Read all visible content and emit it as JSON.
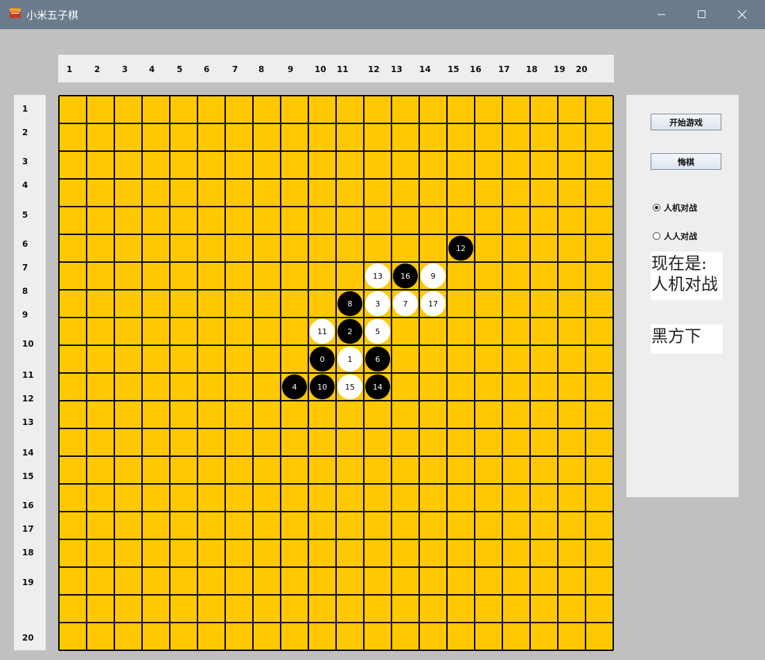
{
  "window": {
    "title": "小米五子棋",
    "controls": [
      "minimize",
      "maximize",
      "close"
    ]
  },
  "board": {
    "columns": [
      "1",
      "2",
      "3",
      "4",
      "5",
      "6",
      "7",
      "8",
      "9",
      "10",
      "11",
      "12",
      "13",
      "14",
      "15",
      "16",
      "17",
      "18",
      "19",
      "20"
    ],
    "rows": [
      "1",
      "2",
      "3",
      "4",
      "5",
      "6",
      "7",
      "8",
      "9",
      "10",
      "11",
      "12",
      "13",
      "14",
      "15",
      "16",
      "17",
      "18",
      "19",
      "20"
    ],
    "board_color": "#FFC800",
    "line_color": "#000000",
    "stones": [
      {
        "label": "12",
        "color": "black",
        "row": 6,
        "col": 15
      },
      {
        "label": "13",
        "color": "white",
        "row": 7,
        "col": 12
      },
      {
        "label": "16",
        "color": "black",
        "row": 7,
        "col": 13
      },
      {
        "label": "9",
        "color": "white",
        "row": 7,
        "col": 14
      },
      {
        "label": "8",
        "color": "black",
        "row": 8,
        "col": 11
      },
      {
        "label": "3",
        "color": "white",
        "row": 8,
        "col": 12
      },
      {
        "label": "7",
        "color": "white",
        "row": 8,
        "col": 13
      },
      {
        "label": "17",
        "color": "white",
        "row": 8,
        "col": 14
      },
      {
        "label": "11",
        "color": "white",
        "row": 9,
        "col": 10
      },
      {
        "label": "2",
        "color": "black",
        "row": 9,
        "col": 11
      },
      {
        "label": "5",
        "color": "white",
        "row": 9,
        "col": 12
      },
      {
        "label": "0",
        "color": "black",
        "row": 10,
        "col": 10
      },
      {
        "label": "1",
        "color": "white",
        "row": 10,
        "col": 11
      },
      {
        "label": "6",
        "color": "black",
        "row": 10,
        "col": 12
      },
      {
        "label": "4",
        "color": "black",
        "row": 11,
        "col": 9
      },
      {
        "label": "10",
        "color": "black",
        "row": 11,
        "col": 10
      },
      {
        "label": "15",
        "color": "white",
        "row": 11,
        "col": 11
      },
      {
        "label": "14",
        "color": "black",
        "row": 11,
        "col": 12
      }
    ]
  },
  "panel": {
    "start_button": "开始游戏",
    "undo_button": "悔棋",
    "mode_options": [
      {
        "label": "人机对战",
        "selected": true
      },
      {
        "label": "人人对战",
        "selected": false
      }
    ],
    "status_line1": "现在是:",
    "status_line2": "人机对战",
    "turn_text": "黑方下"
  }
}
